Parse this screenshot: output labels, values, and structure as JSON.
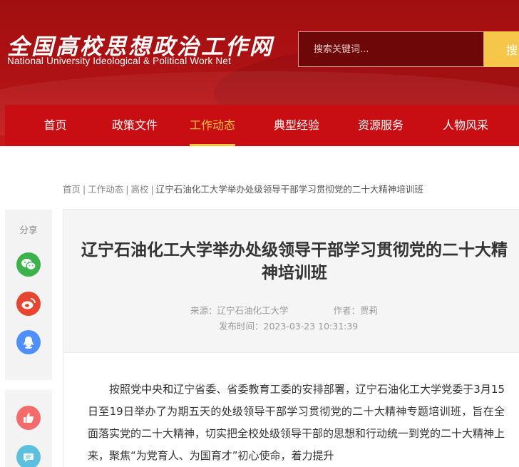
{
  "header": {
    "logo_cn": "全国高校思想政治工作网",
    "logo_en": "National University Ideological & Political Work Net",
    "search_placeholder": "搜索关键词...",
    "search_button": "搜"
  },
  "nav": {
    "items": [
      {
        "label": "首页",
        "active": false
      },
      {
        "label": "政策文件",
        "active": false
      },
      {
        "label": "工作动态",
        "active": true
      },
      {
        "label": "典型经验",
        "active": false
      },
      {
        "label": "资源服务",
        "active": false
      },
      {
        "label": "人物风采",
        "active": false
      }
    ]
  },
  "breadcrumb": {
    "items": [
      "首页",
      "工作动态",
      "高校"
    ],
    "separator": "|",
    "current": "辽宁石油化工大学举办处级领导干部学习贯彻党的二十大精神培训班"
  },
  "share": {
    "label": "分享",
    "icons": [
      "wechat-icon",
      "weibo-icon",
      "qq-icon"
    ],
    "colors": {
      "wechat": "#3cb34a",
      "weibo": "#e6462f",
      "qq": "#4d90fe",
      "like": "#f36b6b",
      "comment": "#5bc0de"
    }
  },
  "article": {
    "title": "辽宁石油化工大学举办处级领导干部学习贯彻党的二十大精神培训班",
    "source": "来源：辽宁石油化工大学",
    "author": "作者：贾莉",
    "publish_time": "发布时间：2023-03-23 10:31:39",
    "body": "按照党中央和辽宁省委、省委教育工委的安排部署，辽宁石油化工大学党委于3月15日至19日举办了为期五天的处级领导干部学习贯彻党的二十大精神专题培训班，旨在全面落实党的二十大精神，切实把全校处级领导干部的思想和行动统一到党的二十大精神上来，聚焦“为党育人、为国育才”初心使命，着力提升"
  },
  "colors": {
    "header_red": "#b01214",
    "nav_red": "#c80e12",
    "active_gold": "#f4c23f",
    "search_button": "#f6c64a"
  }
}
